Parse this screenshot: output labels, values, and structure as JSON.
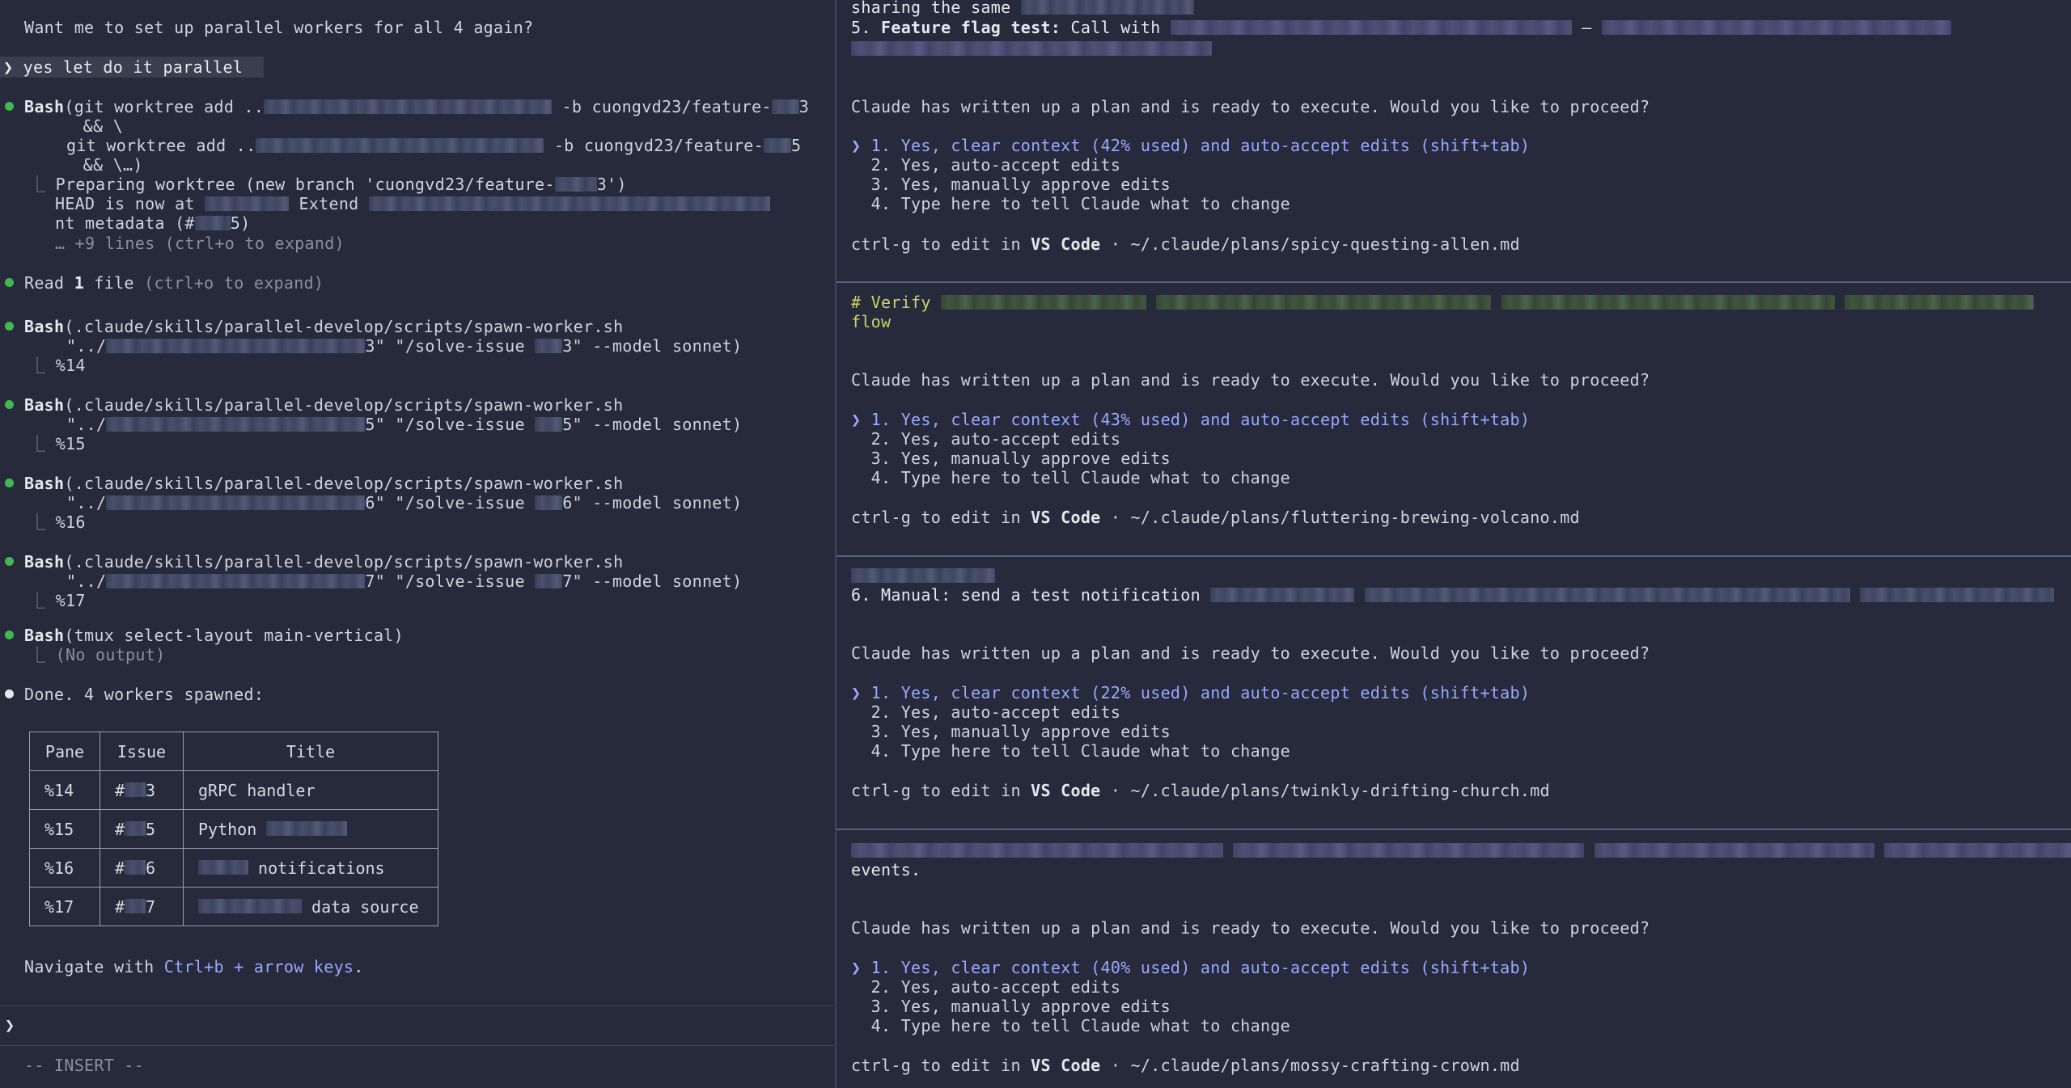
{
  "left": {
    "question": "Want me to set up parallel workers for all 4 again?",
    "prompt_echo": "❯ yes let do it parallel",
    "worktree": {
      "tool": "Bash",
      "cmd1_start": "(git worktree add ..",
      "cmd1_end": " -b cuongvd23/feature-",
      "cmd1_suffix": "3",
      "cont1": "  && \\",
      "cmd2_start": "git worktree add ..",
      "cmd2_end": " -b cuongvd23/feature-",
      "cmd2_suffix": "5",
      "cont2": "  && \\…)",
      "out1": "Preparing worktree (new branch 'cuongvd23/feature-",
      "out1_suffix": "3')",
      "out2_start": "HEAD is now at ",
      "out2_mid": " Extend ",
      "out3_start": "nt metadata (#",
      "out3_end": "5)",
      "more": "… +9 lines (ctrl+o to expand)"
    },
    "read": {
      "prefix": "Read ",
      "count": "1",
      "suffix": " file",
      "hint": " (ctrl+o to expand)"
    },
    "spawns": [
      {
        "tool": "Bash",
        "cmd": "(.claude/skills/parallel-develop/scripts/spawn-worker.sh",
        "arg_start": "\"../",
        "arg_mid": "3\" \"/solve-issue ",
        "arg_end": "3\" --model sonnet)",
        "out": "%14"
      },
      {
        "tool": "Bash",
        "cmd": "(.claude/skills/parallel-develop/scripts/spawn-worker.sh",
        "arg_start": "\"../",
        "arg_mid": "5\" \"/solve-issue ",
        "arg_end": "5\" --model sonnet)",
        "out": "%15"
      },
      {
        "tool": "Bash",
        "cmd": "(.claude/skills/parallel-develop/scripts/spawn-worker.sh",
        "arg_start": "\"../",
        "arg_mid": "6\" \"/solve-issue ",
        "arg_end": "6\" --model sonnet)",
        "out": "%16"
      },
      {
        "tool": "Bash",
        "cmd": "(.claude/skills/parallel-develop/scripts/spawn-worker.sh",
        "arg_start": "\"../",
        "arg_mid": "7\" \"/solve-issue ",
        "arg_end": "7\" --model sonnet)",
        "out": "%17"
      }
    ],
    "tmux": {
      "tool": "Bash",
      "cmd": "(tmux select-layout main-vertical)",
      "out": "(No output)"
    },
    "done": "Done. 4 workers spawned:",
    "table": {
      "headers": [
        "Pane",
        "Issue",
        "Title"
      ],
      "rows": [
        {
          "pane": "%14",
          "issue_prefix": "#",
          "issue_suffix": "3",
          "title_pre": "",
          "title_post": "gRPC handler"
        },
        {
          "pane": "%15",
          "issue_prefix": "#",
          "issue_suffix": "5",
          "title_pre": "Python ",
          "title_post": ""
        },
        {
          "pane": "%16",
          "issue_prefix": "#",
          "issue_suffix": "6",
          "title_pre": "",
          "title_post": " notifications"
        },
        {
          "pane": "%17",
          "issue_prefix": "#",
          "issue_suffix": "7",
          "title_pre": "",
          "title_post": " data source"
        }
      ]
    },
    "navigate_prefix": "Navigate with ",
    "navigate_keys": "Ctrl+b + arrow keys",
    "navigate_suffix": ".",
    "input_prompt": "❯",
    "mode": "-- INSERT --"
  },
  "panes": [
    {
      "top_line_a": "sharing the same ",
      "top_line_b_num": "5. ",
      "top_line_b_bold": "Feature flag test:",
      "top_line_b_rest": " Call with ",
      "top_line_b_dash": " — ",
      "question": "Claude has written up a plan and is ready to execute. Would you like to proceed?",
      "options": [
        "❯ 1. Yes, clear context (42% used) and auto-accept edits (shift+tab)",
        "  2. Yes, auto-accept edits",
        "  3. Yes, manually approve edits",
        "  4. Type here to tell Claude what to change"
      ],
      "footer_prefix": "ctrl-g to edit in ",
      "footer_editor": "VS Code",
      "footer_path": " · ~/.claude/plans/spicy-questing-allen.md"
    },
    {
      "top_line_a": "# Verify ",
      "top_line_b": "flow",
      "question": "Claude has written up a plan and is ready to execute. Would you like to proceed?",
      "options": [
        "❯ 1. Yes, clear context (43% used) and auto-accept edits (shift+tab)",
        "  2. Yes, auto-accept edits",
        "  3. Yes, manually approve edits",
        "  4. Type here to tell Claude what to change"
      ],
      "footer_prefix": "ctrl-g to edit in ",
      "footer_editor": "VS Code",
      "footer_path": " · ~/.claude/plans/fluttering-brewing-volcano.md"
    },
    {
      "top_line_b": "6. Manual: send a test notification ",
      "question": "Claude has written up a plan and is ready to execute. Would you like to proceed?",
      "options": [
        "❯ 1. Yes, clear context (22% used) and auto-accept edits (shift+tab)",
        "  2. Yes, auto-accept edits",
        "  3. Yes, manually approve edits",
        "  4. Type here to tell Claude what to change"
      ],
      "footer_prefix": "ctrl-g to edit in ",
      "footer_editor": "VS Code",
      "footer_path": " · ~/.claude/plans/twinkly-drifting-church.md"
    },
    {
      "top_line_b": "events.",
      "question": "Claude has written up a plan and is ready to execute. Would you like to proceed?",
      "options": [
        "❯ 1. Yes, clear context (40% used) and auto-accept edits (shift+tab)",
        "  2. Yes, auto-accept edits",
        "  3. Yes, manually approve edits",
        "  4. Type here to tell Claude what to change"
      ],
      "footer_prefix": "ctrl-g to edit in ",
      "footer_editor": "VS Code",
      "footer_path": " · ~/.claude/plans/mossy-crafting-crown.md"
    }
  ],
  "colors": {
    "background": "#262a3a",
    "success_dot": "#3fb950",
    "accent_blue": "#9aa8ff",
    "divider": "#3f4560"
  }
}
